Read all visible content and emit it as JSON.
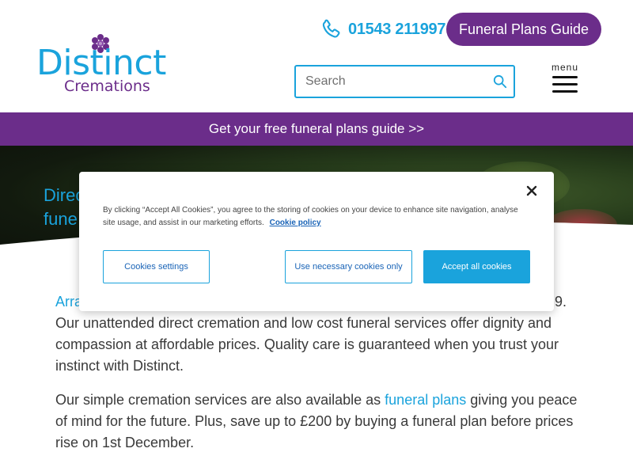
{
  "header": {
    "logo_word": "Distinct",
    "logo_sub": "Cremations",
    "phone_number": "01543 211997",
    "guide_button": "Funeral Plans Guide",
    "search_placeholder": "Search",
    "menu_label": "menu"
  },
  "banner": {
    "text": "Get your free funeral plans guide >>"
  },
  "hero": {
    "title_line1": "Direc",
    "title_line2": "fune"
  },
  "content": {
    "para1_start": "Arra",
    "para1_end": "9.",
    "para1_line2": "Our unattended direct cremation and low cost funeral services offer dignity and",
    "para1_line3": "compassion at affordable prices. Quality care is guaranteed when you trust your",
    "para1_line4": "instinct with Distinct.",
    "para2_before_link": "Our simple cremation services are also available as ",
    "para2_link": "funeral plans",
    "para2_after_link": " giving you peace",
    "para2_line2": "of mind for the future. Plus, save up to £200 by buying a funeral plan before prices",
    "para2_line3": "rise on 1st December."
  },
  "cookie": {
    "text": "By clicking “Accept All Cookies”, you agree to the storing of cookies on your device to enhance site navigation, analyse site usage, and assist in our marketing efforts.",
    "policy_link": "Cookie policy",
    "settings_button": "Cookies settings",
    "necessary_button": "Use necessary cookies only",
    "accept_button": "Accept all cookies"
  },
  "colors": {
    "brand_blue": "#1aa3dc",
    "brand_purple": "#6b2d8a"
  },
  "icons": {
    "phone": "phone-icon",
    "search": "search-icon",
    "menu": "hamburger-icon",
    "close": "close-icon",
    "logo": "flower-logo-icon"
  }
}
